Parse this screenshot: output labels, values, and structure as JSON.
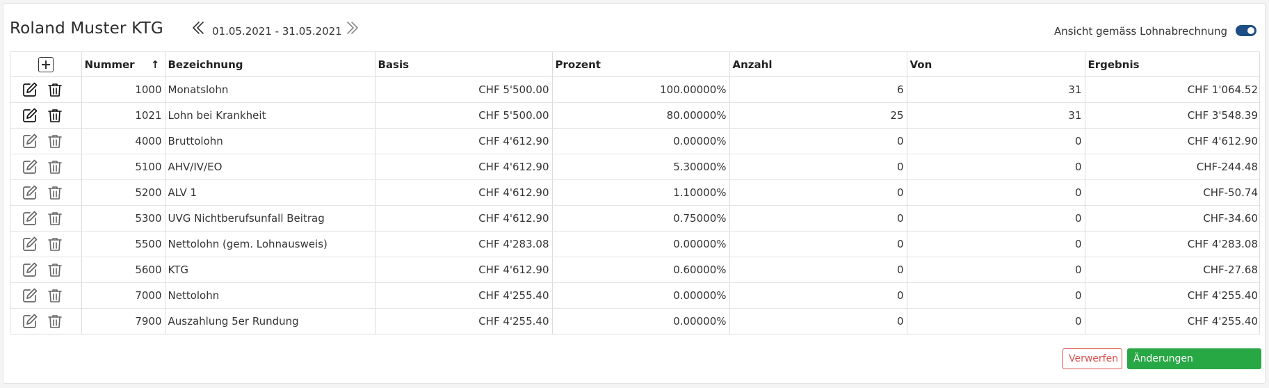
{
  "header": {
    "title": "Roland Muster KTG",
    "period": "01.05.2021 - 31.05.2021",
    "toggle_label": "Ansicht gemäss Lohnabrechnung",
    "toggle_on": true
  },
  "table": {
    "columns": {
      "nummer": "Nummer",
      "bezeichnung": "Bezeichnung",
      "basis": "Basis",
      "prozent": "Prozent",
      "anzahl": "Anzahl",
      "von": "Von",
      "ergebnis": "Ergebnis"
    },
    "rows": [
      {
        "nummer": "1000",
        "bezeichnung": "Monatslohn",
        "basis": "CHF 5'500.00",
        "prozent": "100.00000%",
        "anzahl": "6",
        "von": "31",
        "ergebnis": "CHF 1'064.52",
        "editable": true
      },
      {
        "nummer": "1021",
        "bezeichnung": "Lohn bei Krankheit",
        "basis": "CHF 5'500.00",
        "prozent": "80.00000%",
        "anzahl": "25",
        "von": "31",
        "ergebnis": "CHF 3'548.39",
        "editable": true
      },
      {
        "nummer": "4000",
        "bezeichnung": "Bruttolohn",
        "basis": "CHF 4'612.90",
        "prozent": "0.00000%",
        "anzahl": "0",
        "von": "0",
        "ergebnis": "CHF 4'612.90",
        "editable": false
      },
      {
        "nummer": "5100",
        "bezeichnung": "AHV/IV/EO",
        "basis": "CHF 4'612.90",
        "prozent": "5.30000%",
        "anzahl": "0",
        "von": "0",
        "ergebnis": "CHF-244.48",
        "editable": false
      },
      {
        "nummer": "5200",
        "bezeichnung": "ALV 1",
        "basis": "CHF 4'612.90",
        "prozent": "1.10000%",
        "anzahl": "0",
        "von": "0",
        "ergebnis": "CHF-50.74",
        "editable": false
      },
      {
        "nummer": "5300",
        "bezeichnung": "UVG Nichtberufsunfall Beitrag",
        "basis": "CHF 4'612.90",
        "prozent": "0.75000%",
        "anzahl": "0",
        "von": "0",
        "ergebnis": "CHF-34.60",
        "editable": false
      },
      {
        "nummer": "5500",
        "bezeichnung": "Nettolohn (gem. Lohnausweis)",
        "basis": "CHF 4'283.08",
        "prozent": "0.00000%",
        "anzahl": "0",
        "von": "0",
        "ergebnis": "CHF 4'283.08",
        "editable": false
      },
      {
        "nummer": "5600",
        "bezeichnung": "KTG",
        "basis": "CHF 4'612.90",
        "prozent": "0.60000%",
        "anzahl": "0",
        "von": "0",
        "ergebnis": "CHF-27.68",
        "editable": false
      },
      {
        "nummer": "7000",
        "bezeichnung": "Nettolohn",
        "basis": "CHF 4'255.40",
        "prozent": "0.00000%",
        "anzahl": "0",
        "von": "0",
        "ergebnis": "CHF 4'255.40",
        "editable": false
      },
      {
        "nummer": "7900",
        "bezeichnung": "Auszahlung 5er Rundung",
        "basis": "CHF 4'255.40",
        "prozent": "0.00000%",
        "anzahl": "0",
        "von": "0",
        "ergebnis": "CHF 4'255.40",
        "editable": false
      }
    ]
  },
  "footer": {
    "discard_label": "Verwerfen",
    "apply_label": "Änderungen übernehmen"
  },
  "colors": {
    "toggle": "#1d4f86",
    "discard": "#d9534f",
    "apply": "#28a745"
  },
  "icons": {
    "add": "plus-square-icon",
    "sort": "arrow-up-icon",
    "edit": "edit-pencil-icon",
    "delete": "trash-icon",
    "prev": "double-chevron-left-icon",
    "next": "double-chevron-right-icon"
  }
}
